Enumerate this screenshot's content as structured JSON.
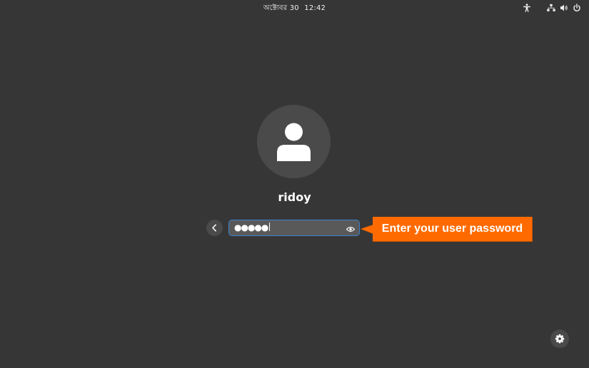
{
  "topbar": {
    "date": "অক্টোবর 30",
    "time": "12:42",
    "icons": [
      "accessibility-icon",
      "network-icon",
      "volume-icon",
      "power-icon"
    ]
  },
  "login": {
    "username": "ridoy",
    "password_masked": "●●●●●",
    "icons": [
      "user-avatar-icon",
      "back-arrow-icon",
      "show-password-eye-icon",
      "settings-gear-icon"
    ]
  },
  "annotation": {
    "text": "Enter your user password",
    "color": "#ff6a00"
  },
  "colors": {
    "background": "#363636",
    "field_border": "#3f82d1",
    "field_bg": "#595959",
    "button_bg": "#4a4a4a"
  }
}
